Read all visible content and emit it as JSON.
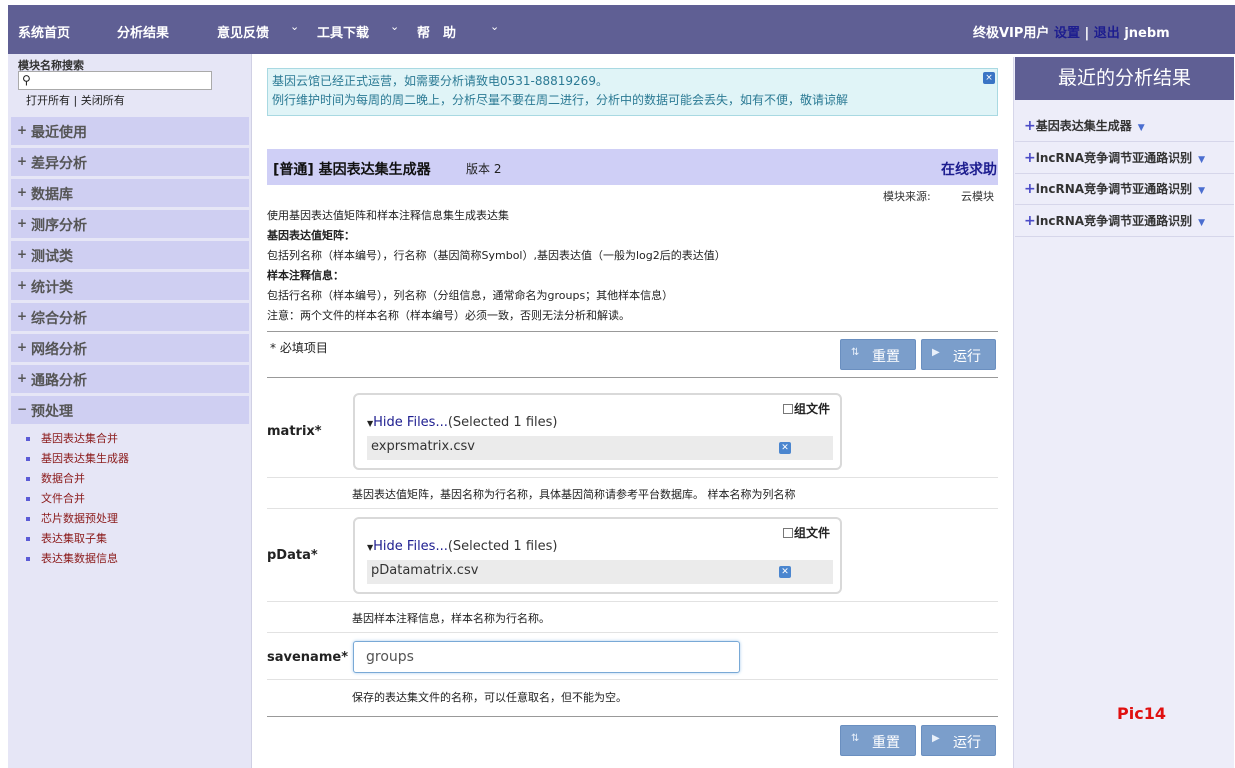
{
  "nav": {
    "items": [
      "系统首页",
      "分析结果",
      "意见反馈",
      "工具下载",
      "帮　助"
    ],
    "user_type": "终极VIP用户",
    "settings": "设置",
    "separator": "|",
    "logout": "退出",
    "username": "jnebm"
  },
  "sidebar": {
    "search_title": "模块名称搜索",
    "search_value": "",
    "open_all": "打开所有",
    "link_separator": "|",
    "close_all": "关闭所有",
    "categories": [
      {
        "label": "最近使用",
        "sign": "+"
      },
      {
        "label": "差异分析",
        "sign": "+"
      },
      {
        "label": "数据库",
        "sign": "+"
      },
      {
        "label": "测序分析",
        "sign": "+"
      },
      {
        "label": "测试类",
        "sign": "+"
      },
      {
        "label": "统计类",
        "sign": "+"
      },
      {
        "label": "综合分析",
        "sign": "+"
      },
      {
        "label": "网络分析",
        "sign": "+"
      },
      {
        "label": "通路分析",
        "sign": "+"
      },
      {
        "label": "预处理",
        "sign": "−"
      }
    ],
    "subitems": [
      "基因表达集合并",
      "基因表达集生成器",
      "数据合并",
      "文件合并",
      "芯片数据预处理",
      "表达集取子集",
      "表达集数据信息"
    ]
  },
  "notice": {
    "line1": "基因云馆已经正式运营，如需要分析请致电0531-88819269。",
    "line2": "例行维护时间为每周的周二晚上，分析尽量不要在周二进行，分析中的数据可能会丢失，如有不便，敬请谅解",
    "close": "×"
  },
  "module": {
    "title": "[普通] 基因表达集生成器",
    "version": "版本 2",
    "help": "在线求助",
    "source_label": "模块来源:",
    "source_value": "云模块",
    "desc": [
      "使用基因表达值矩阵和样本注释信息集生成表达集",
      "基因表达值矩阵：",
      "包括列名称（样本编号），行名称（基因简称Symbol）,基因表达值（一般为log2后的表达值）",
      "样本注释信息：",
      "包括行名称（样本编号），列名称（分组信息，通常命名为groups；其他样本信息）",
      "注意：两个文件的样本名称（样本编号）必须一致，否则无法分析和解读。"
    ],
    "required_note": "* 必填项目",
    "reset_label": "重置",
    "run_label": "运行"
  },
  "params": {
    "matrix": {
      "label": "matrix*",
      "group_label": "组文件",
      "hide_files": "Hide Files...",
      "selected": "(Selected 1 files)",
      "file": "exprsmatrix.csv",
      "desc": "基因表达值矩阵，基因名称为行名称，具体基因简称请参考平台数据库。 样本名称为列名称"
    },
    "pdata": {
      "label": "pData*",
      "group_label": "组文件",
      "hide_files": "Hide Files...",
      "selected": "(Selected 1 files)",
      "file": "pDatamatrix.csv",
      "desc": "基因样本注释信息，样本名称为行名称。"
    },
    "savename": {
      "label": "savename*",
      "value": "groups",
      "desc": "保存的表达集文件的名称，可以任意取名，但不能为空。"
    }
  },
  "recent": {
    "title": "最近的分析结果",
    "items": [
      "基因表达集生成器",
      "lncRNA竞争调节亚通路识别",
      "lncRNA竞争调节亚通路识别",
      "lncRNA竞争调节亚通路识别"
    ]
  },
  "watermark": "Pic14"
}
